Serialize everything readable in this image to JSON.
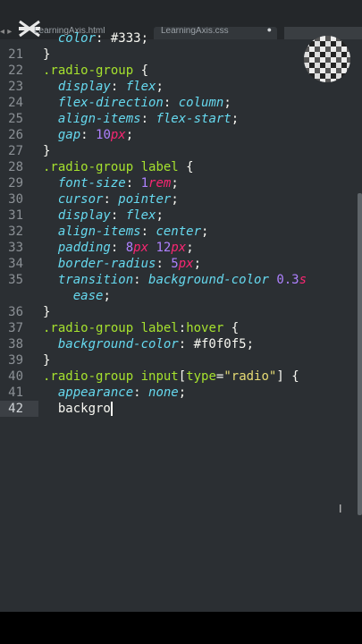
{
  "tabs": [
    {
      "label": "LearningAxis.html",
      "close": ""
    },
    {
      "label": "LearningAxis.css",
      "close": "●"
    },
    {
      "label": "",
      "close": ""
    }
  ],
  "nav": {
    "arrows": "◂ ▸"
  },
  "lines": [
    {
      "n": "",
      "text": "  color: #333;"
    },
    {
      "n": "21",
      "text": "}"
    },
    {
      "n": "22",
      "text": ".radio-group {"
    },
    {
      "n": "23",
      "text": "  display: flex;"
    },
    {
      "n": "24",
      "text": "  flex-direction: column;"
    },
    {
      "n": "25",
      "text": "  align-items: flex-start;"
    },
    {
      "n": "26",
      "text": "  gap: 10px;"
    },
    {
      "n": "27",
      "text": "}"
    },
    {
      "n": "28",
      "text": ".radio-group label {"
    },
    {
      "n": "29",
      "text": "  font-size: 1rem;"
    },
    {
      "n": "30",
      "text": "  cursor: pointer;"
    },
    {
      "n": "31",
      "text": "  display: flex;"
    },
    {
      "n": "32",
      "text": "  align-items: center;"
    },
    {
      "n": "33",
      "text": "  padding: 8px 12px;"
    },
    {
      "n": "34",
      "text": "  border-radius: 5px;"
    },
    {
      "n": "35",
      "text": "  transition: background-color 0.3s"
    },
    {
      "n": "",
      "text": "    ease;"
    },
    {
      "n": "36",
      "text": "}"
    },
    {
      "n": "37",
      "text": ".radio-group label:hover {"
    },
    {
      "n": "38",
      "text": "  background-color: #f0f0f5;"
    },
    {
      "n": "39",
      "text": "}"
    },
    {
      "n": "40",
      "text": ".radio-group input[type=\"radio\"] {"
    },
    {
      "n": "41",
      "text": "  appearance: none;"
    },
    {
      "n": "42",
      "text": "  backgro"
    }
  ],
  "icons": {
    "ibeam": "I"
  },
  "colors": {
    "background": "#2b2f33",
    "selector": "#a6e22e",
    "property": "#66d9ef",
    "number": "#ae81ff",
    "unit": "#f92672",
    "string": "#e6db74"
  }
}
